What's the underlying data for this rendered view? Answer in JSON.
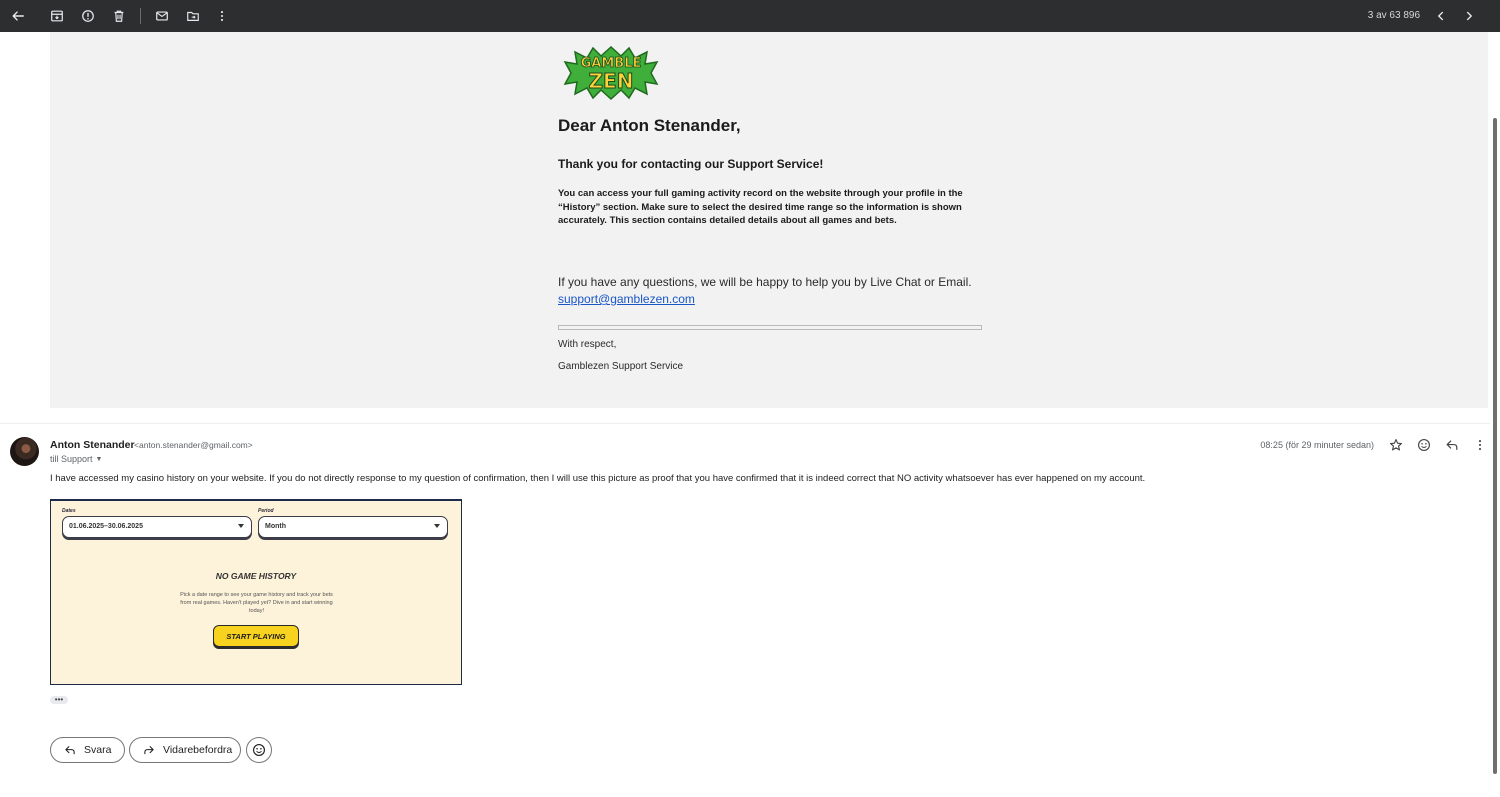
{
  "toolbar": {
    "counter": "3 av 63 896",
    "icons": [
      "back-arrow-icon",
      "archive-icon",
      "report-spam-icon",
      "delete-icon",
      "mark-unread-icon",
      "move-to-icon",
      "more-vert-icon",
      "newer-chevron-icon",
      "older-chevron-icon"
    ]
  },
  "quoted": {
    "logo_line1": "GAMBLE",
    "logo_line2": "ZEN",
    "greeting": "Dear Anton Stenander,",
    "thanks": "Thank you for contacting our Support Service!",
    "body": "You can access your full gaming activity record on the website through your profile in the “History” section. Make sure to select the desired time range so the information is shown accurately. This section contains detailed details about all games and bets.",
    "questions": "If you have any questions, we will be happy to help you by Live Chat or Email.",
    "email_link": "support@gamblezen.com",
    "closing": "With respect,",
    "signature": "Gamblezen Support Service"
  },
  "message": {
    "sender_name": "Anton Stenander",
    "sender_email": "<anton.stenander@gmail.com>",
    "recipient": "till Support",
    "time": "08:25 (för 29 minuter sedan)",
    "body": "I have accessed my casino history on your website. If you do not directly response to my question of confirmation, then I will use this picture as proof that you have confirmed that it is indeed correct that NO activity whatsoever has ever happened on my account.",
    "ellipsis": "•••"
  },
  "attachment": {
    "dates_label": "Dates",
    "dates_value": "01.06.2025–30.06.2025",
    "period_label": "Period",
    "period_value": "Month",
    "title": "NO GAME HISTORY",
    "description": "Pick a date range to see your game history and track your bets from real games. Haven't played yet? Dive in and start winning today!",
    "button": "START PLAYING"
  },
  "actions": {
    "reply": "Svara",
    "forward": "Vidarebefordra"
  },
  "colors": {
    "toolbar_bg": "#2d2e30",
    "quoted_bg": "#f2f2f2",
    "link": "#1a56c7",
    "attach_bg": "#fdf2da",
    "attach_button": "#f7d21e"
  }
}
